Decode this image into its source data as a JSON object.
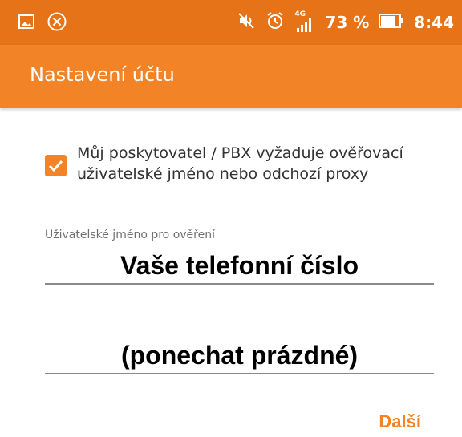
{
  "status_bar": {
    "battery": "73 %",
    "time": "8:44",
    "network": "4G",
    "icons": [
      "image-notification-icon",
      "cancel-icon",
      "mute-icon",
      "alarm-icon",
      "signal-icon",
      "battery-icon"
    ]
  },
  "app_bar": {
    "title": "Nastavení účtu"
  },
  "auth_option": {
    "checked": true,
    "label": "Můj poskytovatel / PBX vyžaduje ověřovací uživatelské jméno nebo odchozí proxy"
  },
  "auth_username": {
    "caption": "Uživatelské jméno pro ověření",
    "value": "Vaše telefonní číslo"
  },
  "outbound_proxy": {
    "value": "(ponechat prázdné)"
  },
  "actions": {
    "next_label": "Další"
  },
  "colors": {
    "status_bar": "#e67317",
    "accent": "#f28327",
    "text": "#333333",
    "underline": "#8a8a8a"
  }
}
